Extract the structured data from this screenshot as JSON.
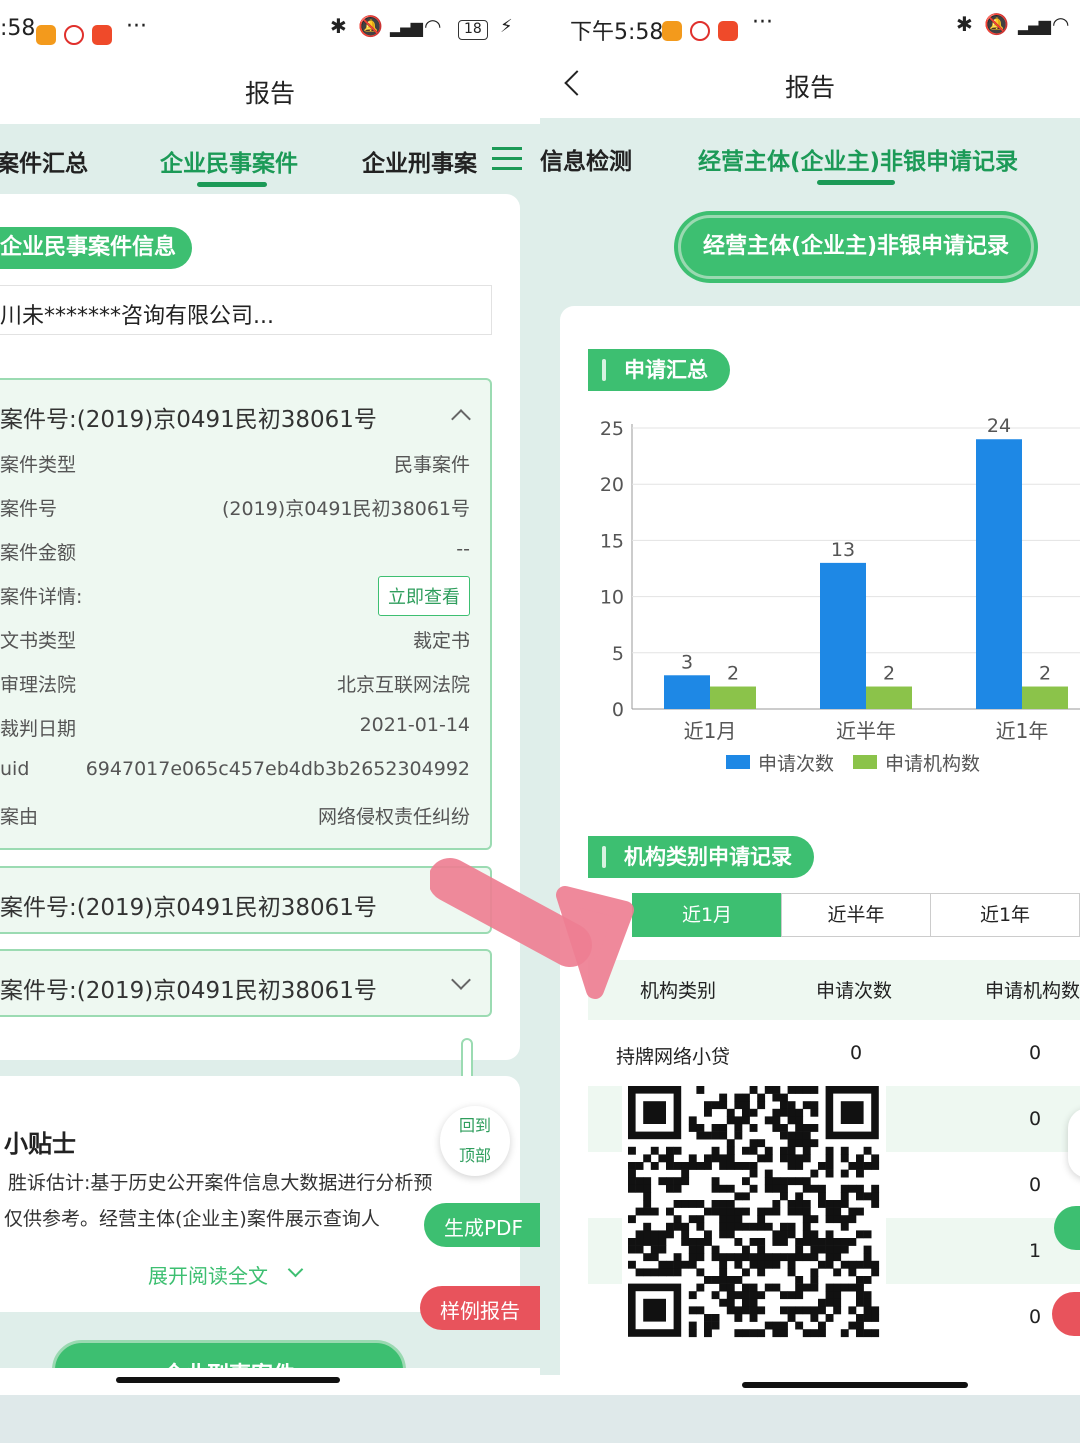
{
  "left": {
    "status": {
      "time": ":58",
      "more": "···",
      "battery": "18"
    },
    "title": "报告",
    "tabs": [
      {
        "label": "案件汇总"
      },
      {
        "label": "企业民事案件",
        "active": true
      },
      {
        "label": "企业刑事案"
      }
    ],
    "section_title": "企业民事案件信息",
    "company_select": "川未*******咨询有限公司...",
    "case_expanded": {
      "title": "案件号:(2019)京0491民初38061号",
      "fields": [
        {
          "k": "案件类型",
          "v": "民事案件"
        },
        {
          "k": "案件号",
          "v": "(2019)京0491民初38061号"
        },
        {
          "k": "案件金额",
          "v": "--"
        },
        {
          "k": "案件详情:",
          "v": "立即查看",
          "button": true
        },
        {
          "k": "文书类型",
          "v": "裁定书"
        },
        {
          "k": "审理法院",
          "v": "北京互联网法院"
        },
        {
          "k": "裁判日期",
          "v": "2021-01-14"
        },
        {
          "k": "uid",
          "v": "6947017e065c457eb4db3b2652304992"
        },
        {
          "k": "案由",
          "v": "网络侵权责任纠纷"
        }
      ]
    },
    "case_collapsed_1": "案件号:(2019)京0491民初38061号",
    "case_collapsed_2": "案件号:(2019)京0491民初38061号",
    "tips": {
      "title": "小贴士",
      "line1": "胜诉估计:基于历史公开案件信息大数据进行分析预",
      "line2": "仅供参考。经营主体(企业主)案件展示查询人",
      "expand": "展开阅读全文"
    },
    "back_top": [
      "回到",
      "顶部"
    ],
    "gen_pdf": "生成PDF",
    "sample_report": "样例报告",
    "bottom_pill": "企业刑事案件"
  },
  "right": {
    "status": {
      "time": "下午5:58",
      "more": "···"
    },
    "title": "报告",
    "tabs": [
      {
        "label": "信息检测"
      },
      {
        "label": "经营主体(企业主)非银申请记录",
        "active": true
      }
    ],
    "banner": "经营主体(企业主)非银申请记录",
    "summary_title": "申请汇总",
    "category_title": "机构类别申请记录",
    "period_tabs": [
      "近1月",
      "近半年",
      "近1年"
    ],
    "table": {
      "headers": [
        "机构类别",
        "申请次数",
        "申请机构数"
      ],
      "rows": [
        {
          "cat": "持牌网络小贷",
          "count": "0",
          "orgs": "0"
        },
        {
          "cat": "",
          "count": "",
          "orgs": "0"
        },
        {
          "cat": "",
          "count": "",
          "orgs": "0"
        },
        {
          "cat": "",
          "count": "",
          "orgs": "1"
        },
        {
          "cat": "",
          "count": "",
          "orgs": "0"
        }
      ]
    }
  },
  "chart_data": {
    "type": "bar",
    "categories": [
      "近1月",
      "近半年",
      "近1年"
    ],
    "series": [
      {
        "name": "申请次数",
        "values": [
          3,
          13,
          24
        ],
        "color": "#1e88e5"
      },
      {
        "name": "申请机构数",
        "values": [
          2,
          2,
          2
        ],
        "color": "#8bc34a"
      }
    ],
    "y_ticks": [
      0,
      5,
      10,
      15,
      20,
      25
    ],
    "ylim": [
      0,
      25
    ],
    "legend": "bottom",
    "data_labels": true
  },
  "colors": {
    "accent": "#3dbf71",
    "accent_dark": "#1c9a57",
    "page_bg": "#dfeeea",
    "pdf_button": "#3dbf71",
    "sample_button": "#e8535c",
    "arrow": "#ee7f93"
  }
}
